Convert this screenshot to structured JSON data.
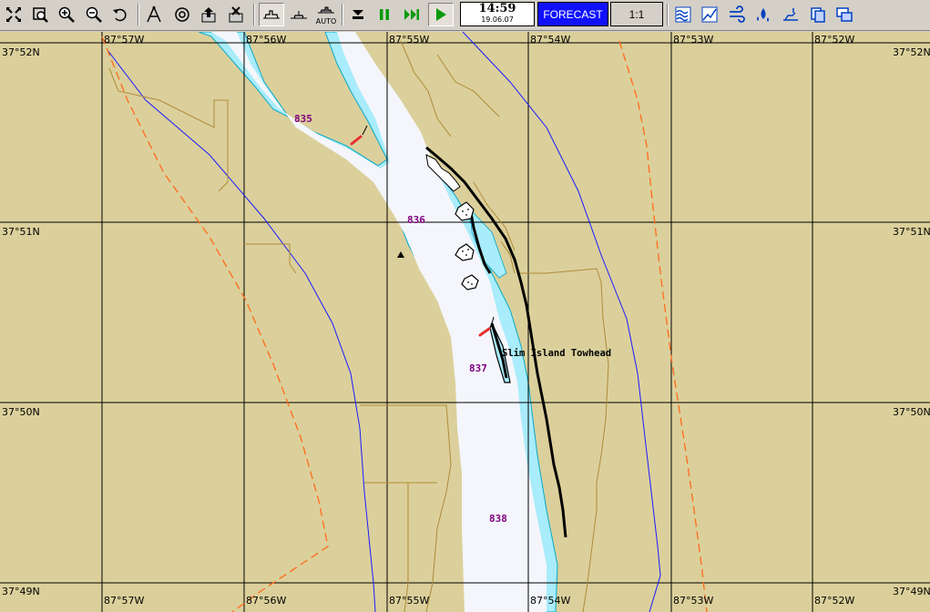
{
  "toolbar": {
    "buttons": [
      {
        "name": "pan-icon",
        "label": "pan"
      },
      {
        "name": "zoom-window-icon",
        "label": "zoom window"
      },
      {
        "name": "zoom-in-icon",
        "label": "zoom in"
      },
      {
        "name": "zoom-out-icon",
        "label": "zoom out"
      },
      {
        "name": "undo-icon",
        "label": "undo"
      },
      {
        "name": "route-icon",
        "label": "route"
      },
      {
        "name": "target-icon",
        "label": "target"
      },
      {
        "name": "export-icon",
        "label": "export"
      },
      {
        "name": "delete-icon",
        "label": "delete"
      },
      {
        "name": "ship-icon",
        "label": "ship view"
      },
      {
        "name": "vessel-icon",
        "label": "vessel"
      },
      {
        "name": "auto-icon",
        "label": "auto"
      }
    ],
    "auto_label": "AUTO",
    "clock_time": "14:59",
    "clock_date": "19.06.07",
    "forecast_label": "FORECAST",
    "scale_label": "1:1"
  },
  "map": {
    "lat_labels": [
      "37°52N",
      "37°51N",
      "37°50N",
      "37°49N"
    ],
    "lon_labels": [
      "87°57W",
      "87°56W",
      "87°55W",
      "87°54W",
      "87°53W",
      "87°52W"
    ],
    "mile_markers": [
      "835",
      "836",
      "837",
      "838"
    ],
    "feature_label": "Slim Island Towhead",
    "colors": {
      "land": "#dbd09b",
      "water_deep": "#f4f6fb",
      "water_shallow": "#a9ecfb",
      "mile_marker": "#800080",
      "contour": "#b08a3a",
      "boundary": "#1a1aff",
      "dashed": "#ff6a1a"
    }
  }
}
